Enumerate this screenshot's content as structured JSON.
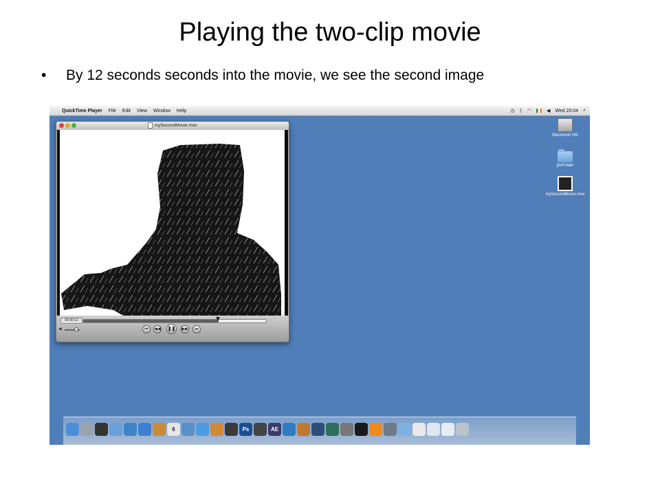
{
  "slide": {
    "title": "Playing the two-clip movie",
    "bullet_symbol": "•",
    "bullet_text": "By 12 seconds seconds into the movie, we see the second image"
  },
  "menubar": {
    "apple_glyph": "",
    "app_name": "QuickTime Player",
    "items": [
      "File",
      "Edit",
      "View",
      "Window",
      "Help"
    ],
    "clock": "Wed 20:04"
  },
  "desktop": {
    "icons": [
      {
        "label": "Macintosh HD",
        "icon": "hard-drive-icon"
      },
      {
        "label": "jimFolder",
        "icon": "folder-icon"
      },
      {
        "label": "mySecondMovie.mov",
        "icon": "movie-file-icon"
      }
    ]
  },
  "player": {
    "window_title": "mySecondMovie.mov",
    "timecode": "00:00:12",
    "playback_progress": 0.74,
    "volume_level": 0.75,
    "controls": [
      "skip-back",
      "rewind",
      "pause",
      "fast-forward",
      "skip-forward"
    ]
  },
  "dock": {
    "icons": [
      {
        "name": "finder-icon",
        "color": "#4a90d9",
        "text": ""
      },
      {
        "name": "system-preferences-icon",
        "color": "#9aa4ae",
        "text": ""
      },
      {
        "name": "dashboard-icon",
        "color": "#333333",
        "text": ""
      },
      {
        "name": "mail-icon",
        "color": "#6aa0d8",
        "text": ""
      },
      {
        "name": "safari-icon",
        "color": "#3e84c8",
        "text": ""
      },
      {
        "name": "ichat-icon",
        "color": "#3b7fd1",
        "text": ""
      },
      {
        "name": "address-book-icon",
        "color": "#c98a3a",
        "text": ""
      },
      {
        "name": "ical-icon",
        "color": "#e6e6e6",
        "text": "6"
      },
      {
        "name": "iphoto-icon",
        "color": "#5b8fc7",
        "text": ""
      },
      {
        "name": "itunes-icon",
        "color": "#4b9be0",
        "text": ""
      },
      {
        "name": "preview-icon",
        "color": "#d08a3a",
        "text": ""
      },
      {
        "name": "aperture-icon",
        "color": "#3a3a3a",
        "text": ""
      },
      {
        "name": "photoshop-icon",
        "color": "#1c4e8f",
        "text": "Ps"
      },
      {
        "name": "final-cut-icon",
        "color": "#444444",
        "text": ""
      },
      {
        "name": "after-effects-icon",
        "color": "#3b3b6b",
        "text": "AE"
      },
      {
        "name": "sync-icon",
        "color": "#2f7bc2",
        "text": ""
      },
      {
        "name": "garageband-icon",
        "color": "#c07a30",
        "text": ""
      },
      {
        "name": "spaces-icon",
        "color": "#2e4e7a",
        "text": ""
      },
      {
        "name": "time-machine-icon",
        "color": "#2c6f5a",
        "text": ""
      },
      {
        "name": "disk-utility-icon",
        "color": "#777777",
        "text": ""
      },
      {
        "name": "terminal-icon",
        "color": "#1a1a1a",
        "text": ""
      },
      {
        "name": "vlc-icon",
        "color": "#f18a1c",
        "text": ""
      },
      {
        "name": "activity-monitor-icon",
        "color": "#6d7a88",
        "text": ""
      },
      {
        "name": "applications-folder-icon",
        "color": "#7fb1e3",
        "text": ""
      },
      {
        "name": "documents-stack-icon",
        "color": "#e9e9e9",
        "text": ""
      },
      {
        "name": "downloads-stack-icon",
        "color": "#dfe7f1",
        "text": ""
      },
      {
        "name": "stack-icon",
        "color": "#e4ecf5",
        "text": ""
      },
      {
        "name": "trash-icon",
        "color": "#b9c3cc",
        "text": ""
      }
    ]
  },
  "colors": {
    "desktop": "#4f7eb8",
    "window_chrome": "#b8b8b8",
    "silhouette": "#1a1a1a"
  }
}
